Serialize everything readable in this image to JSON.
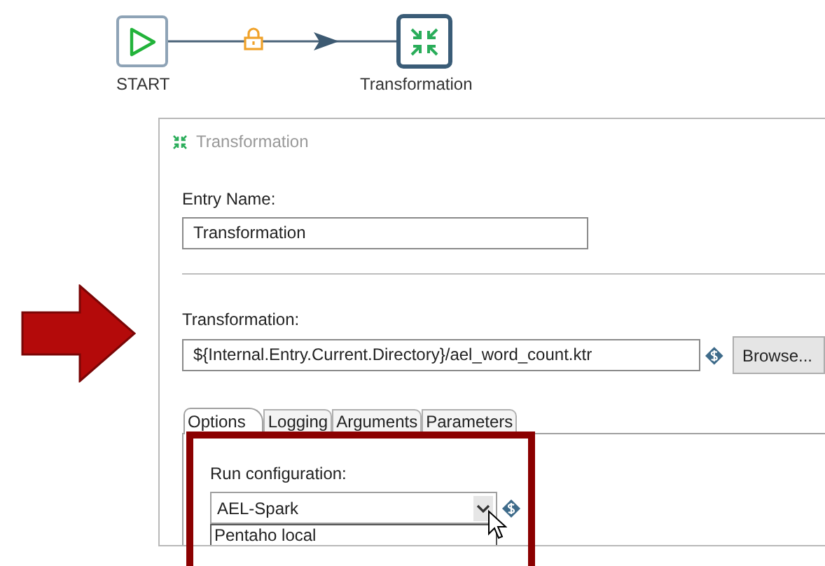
{
  "canvas": {
    "nodes": [
      {
        "kind": "start",
        "label": "START"
      },
      {
        "kind": "transformation",
        "label": "Transformation"
      }
    ]
  },
  "dialog": {
    "title": "Transformation",
    "entry_name": {
      "label": "Entry Name:",
      "value": "Transformation"
    },
    "transformation": {
      "label": "Transformation:",
      "value": "${Internal.Entry.Current.Directory}/ael_word_count.ktr",
      "browse_button": "Browse..."
    },
    "tabs": [
      {
        "label": "Options",
        "selected": true
      },
      {
        "label": "Logging",
        "selected": false
      },
      {
        "label": "Arguments",
        "selected": false
      },
      {
        "label": "Parameters",
        "selected": false
      }
    ],
    "run_configuration": {
      "label": "Run configuration:",
      "value": "AEL-Spark",
      "options": [
        "Pentaho local"
      ]
    }
  }
}
